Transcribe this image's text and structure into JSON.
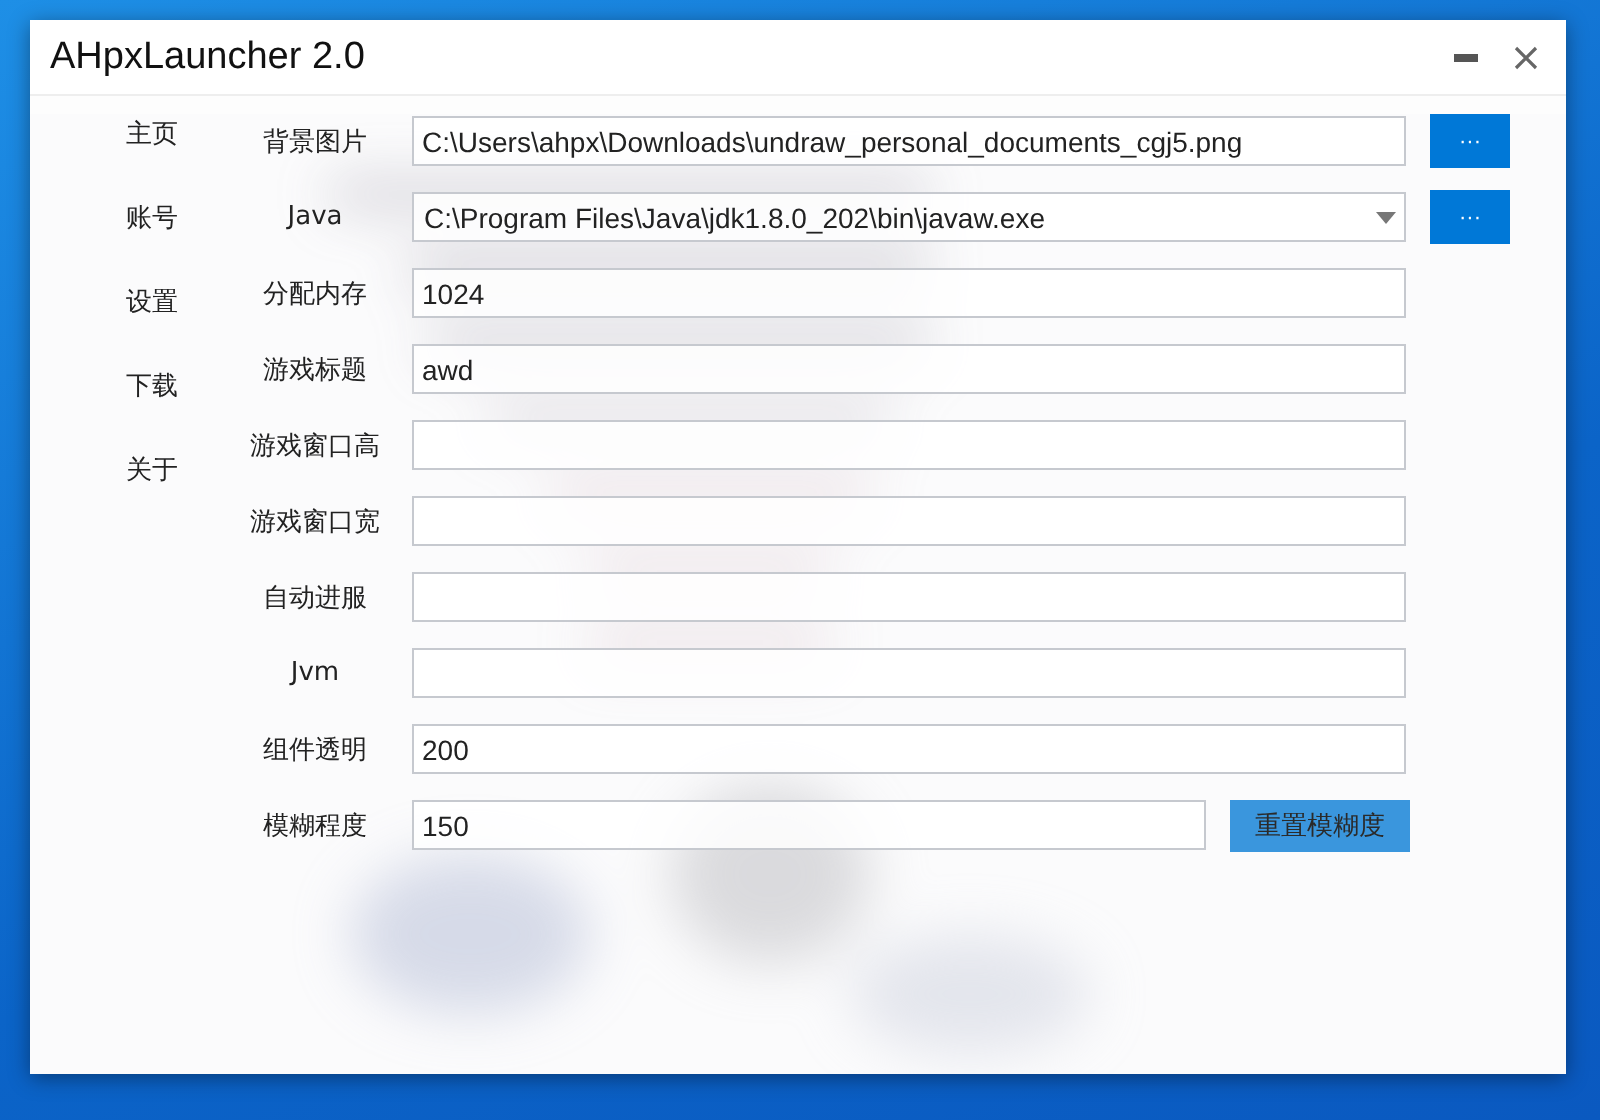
{
  "window": {
    "title": "AHpxLauncher 2.0"
  },
  "sidebar": {
    "items": [
      {
        "label": "主页"
      },
      {
        "label": "账号"
      },
      {
        "label": "设置"
      },
      {
        "label": "下载"
      },
      {
        "label": "关于"
      }
    ]
  },
  "settings": [
    {
      "kind": "text",
      "label": "背景图片",
      "value": "C:\\Users\\ahpx\\Downloads\\undraw_personal_documents_cgj5.png",
      "button": "···"
    },
    {
      "kind": "combo",
      "label": "Java",
      "value": "C:\\Program Files\\Java\\jdk1.8.0_202\\bin\\javaw.exe",
      "button": "···"
    },
    {
      "kind": "text",
      "label": "分配内存",
      "value": "1024"
    },
    {
      "kind": "text",
      "label": "游戏标题",
      "value": "awd"
    },
    {
      "kind": "text",
      "label": "游戏窗口高"
    },
    {
      "kind": "text",
      "label": "游戏窗口宽"
    },
    {
      "kind": "text",
      "label": "自动进服"
    },
    {
      "kind": "text",
      "label": "Jvm"
    },
    {
      "kind": "text",
      "label": "组件透明",
      "value": "200"
    },
    {
      "kind": "text",
      "label": "模糊程度",
      "value": "150",
      "button": "重置模糊度"
    }
  ]
}
